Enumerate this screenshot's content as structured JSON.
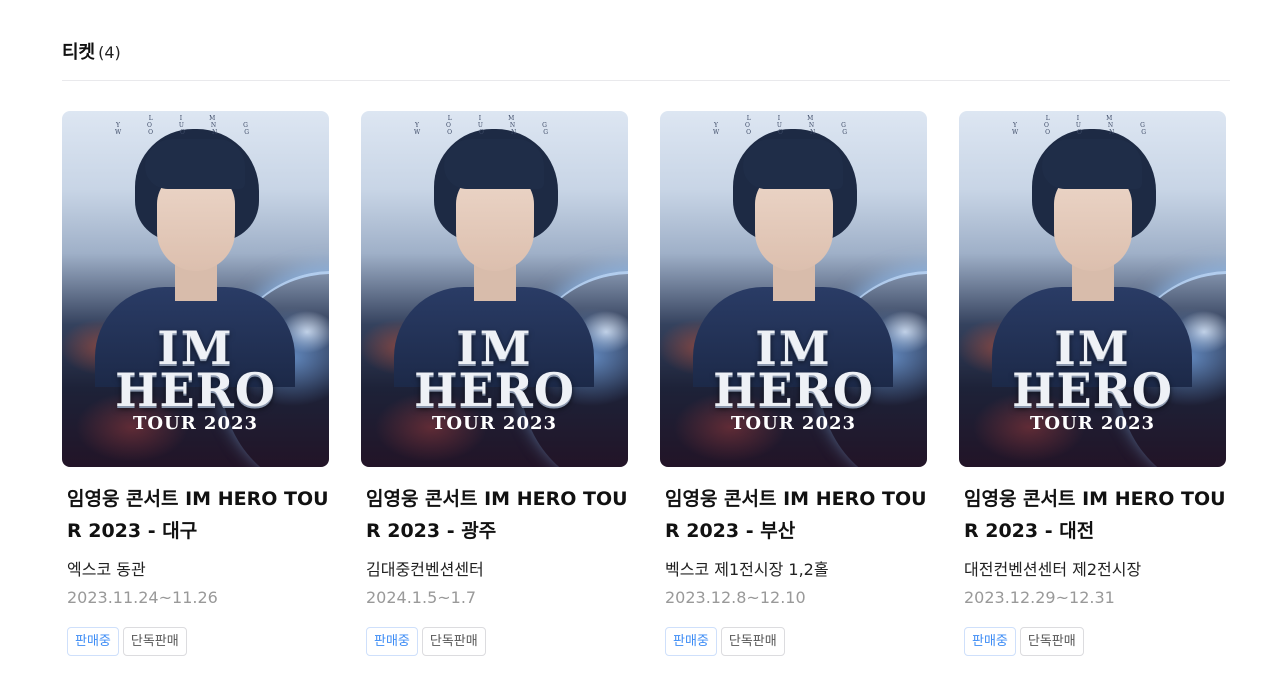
{
  "section": {
    "title": "티켓",
    "count": "(4)"
  },
  "cards": [
    {
      "poster": {
        "top_text": "LIM YOUNG WOONG",
        "logo_line1": "IM",
        "logo_line2": "HERO",
        "logo_line3": "TOUR 2023"
      },
      "title": "임영웅 콘서트 IM HERO TOUR 2023 - 대구",
      "venue": "엑스코 동관",
      "dates": "2023.11.24~11.26",
      "badges": {
        "status": "판매중",
        "exclusive": "단독판매"
      }
    },
    {
      "poster": {
        "top_text": "LIM YOUNG WOONG",
        "logo_line1": "IM",
        "logo_line2": "HERO",
        "logo_line3": "TOUR 2023"
      },
      "title": "임영웅 콘서트 IM HERO TOUR 2023 - 광주",
      "venue": "김대중컨벤션센터",
      "dates": "2024.1.5~1.7",
      "badges": {
        "status": "판매중",
        "exclusive": "단독판매"
      }
    },
    {
      "poster": {
        "top_text": "LIM YOUNG WOONG",
        "logo_line1": "IM",
        "logo_line2": "HERO",
        "logo_line3": "TOUR 2023"
      },
      "title": "임영웅 콘서트 IM HERO TOUR 2023 - 부산",
      "venue": "벡스코 제1전시장 1,2홀",
      "dates": "2023.12.8~12.10",
      "badges": {
        "status": "판매중",
        "exclusive": "단독판매"
      }
    },
    {
      "poster": {
        "top_text": "LIM YOUNG WOONG",
        "logo_line1": "IM",
        "logo_line2": "HERO",
        "logo_line3": "TOUR 2023"
      },
      "title": "임영웅 콘서트 IM HERO TOUR 2023 - 대전",
      "venue": "대전컨벤션센터 제2전시장",
      "dates": "2023.12.29~12.31",
      "badges": {
        "status": "판매중",
        "exclusive": "단독판매"
      }
    }
  ],
  "colors": {
    "highlight": "#ffe33a",
    "status_badge": "#3d8cf5",
    "date_text": "#999999"
  }
}
